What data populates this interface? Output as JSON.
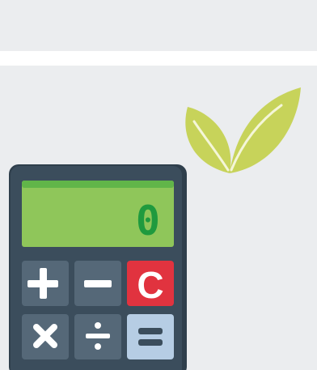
{
  "calculator": {
    "display_value": "0",
    "keys": {
      "plus": "+",
      "minus": "−",
      "clear": "C",
      "multiply": "×",
      "divide": "÷",
      "equals": "="
    }
  },
  "colors": {
    "background": "#ebedef",
    "separator": "#ffffff",
    "body": "#3b4d5c",
    "body_edge": "#2f3f4c",
    "screen": "#8fc65a",
    "screen_top": "#61b549",
    "screen_digit": "#1f9a3e",
    "key": "#556878",
    "key_clear": "#e1333f",
    "key_equals": "#b6cde4",
    "key_equals_glyph": "#3b4d5c",
    "leaf": "#c7d35a",
    "leaf_vein": "#f4f6d8"
  },
  "icons": {
    "leaf": "leaf-icon",
    "calculator": "calculator-icon"
  }
}
